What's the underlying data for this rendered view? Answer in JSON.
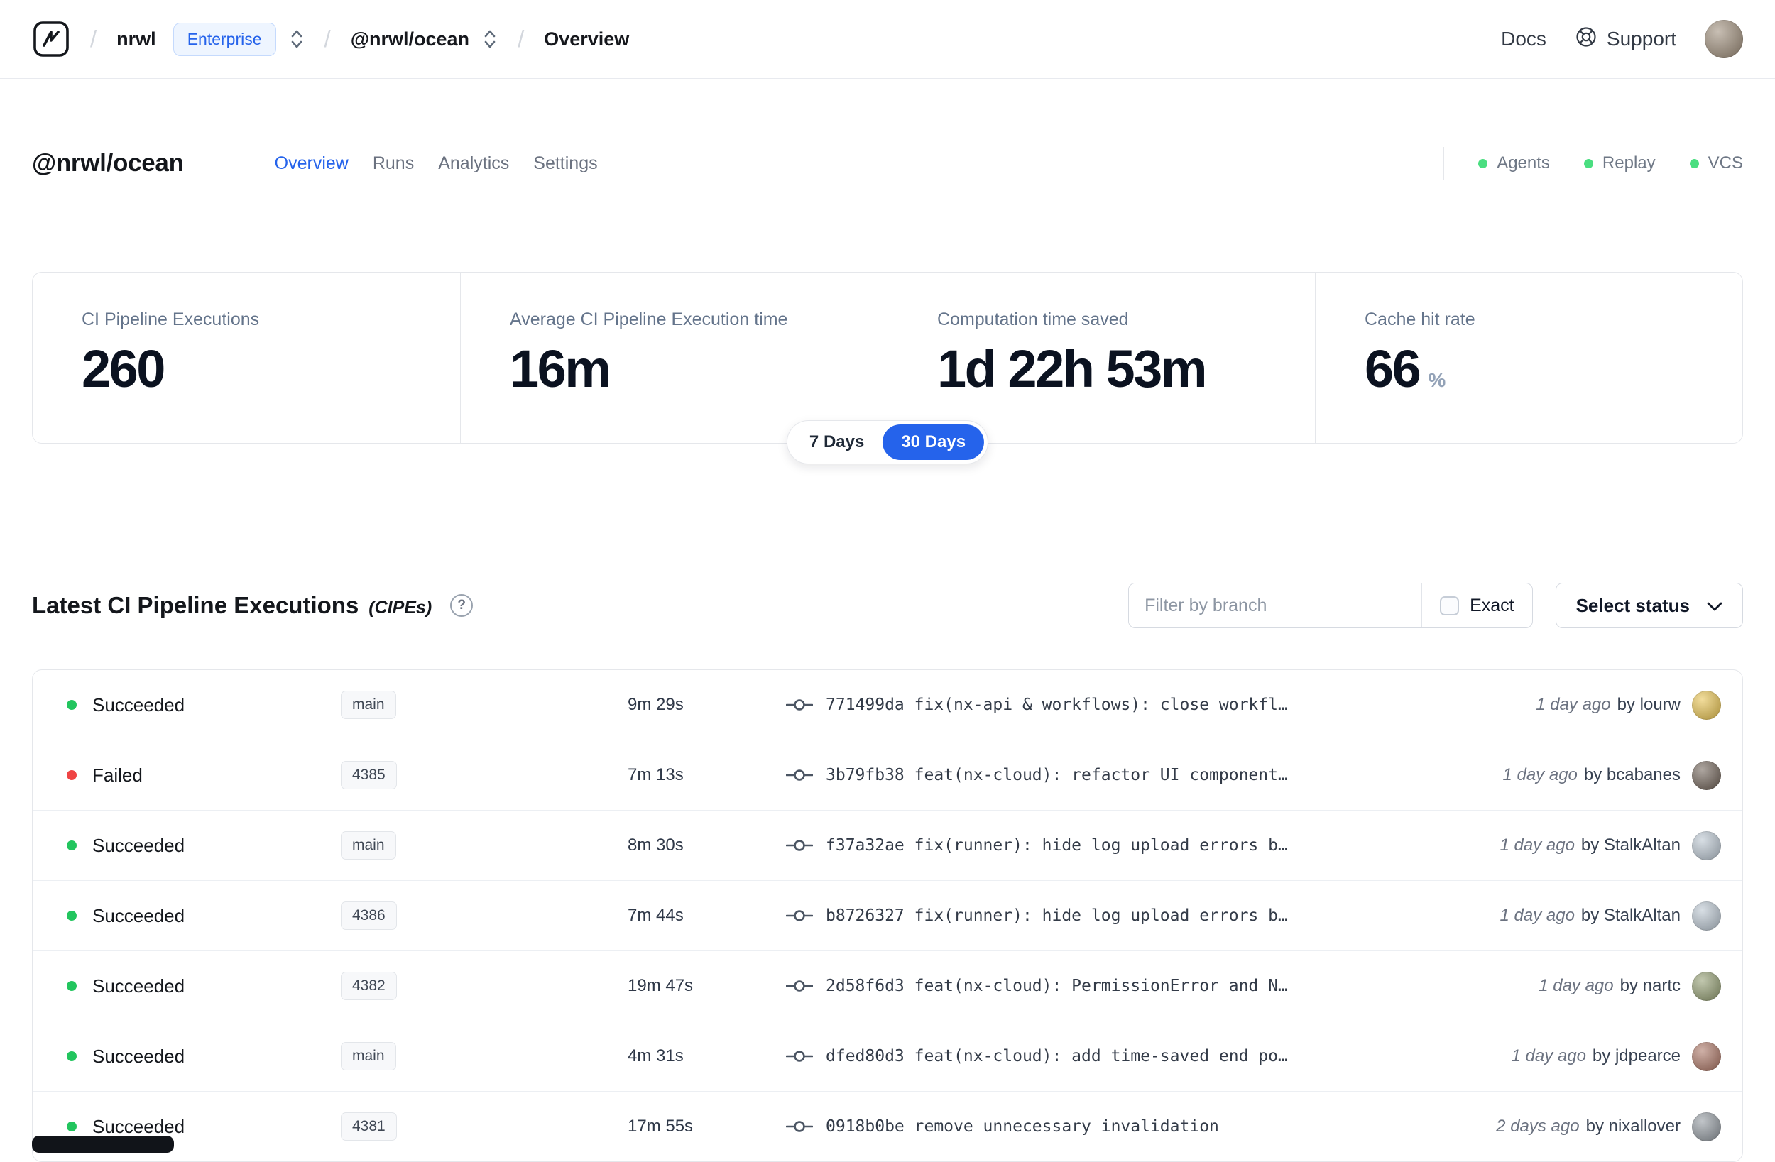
{
  "navbar": {
    "separator": "/",
    "org": "nrwl",
    "badge": "Enterprise",
    "workspace": "@nrwl/ocean",
    "page": "Overview",
    "docs": "Docs",
    "support": "Support"
  },
  "header": {
    "title": "@nrwl/ocean",
    "tabs": [
      {
        "label": "Overview",
        "active": true
      },
      {
        "label": "Runs",
        "active": false
      },
      {
        "label": "Analytics",
        "active": false
      },
      {
        "label": "Settings",
        "active": false
      }
    ],
    "status_dot_color": "#4ade80",
    "statuses": [
      {
        "label": "Agents"
      },
      {
        "label": "Replay"
      },
      {
        "label": "VCS"
      }
    ]
  },
  "stats": {
    "cards": [
      {
        "label": "CI Pipeline Executions",
        "value": "260"
      },
      {
        "label": "Average CI Pipeline Execution time",
        "value": "16m"
      },
      {
        "label": "Computation time saved",
        "value": "1d 22h 53m"
      },
      {
        "label": "Cache hit rate",
        "value": "66",
        "suffix": "%"
      }
    ],
    "range": [
      {
        "label": "7 Days",
        "active": false
      },
      {
        "label": "30 Days",
        "active": true
      }
    ]
  },
  "section": {
    "title": "Latest CI Pipeline Executions",
    "subtitle": "(CIPEs)",
    "help": "?",
    "filter_placeholder": "Filter by branch",
    "exact_label": "Exact",
    "status_select": "Select status"
  },
  "table": {
    "rows": [
      {
        "status": "Succeeded",
        "status_color": "#22c55e",
        "branch": "main",
        "duration": "9m 29s",
        "commit": "771499da fix(nx-api & workflows): close workfl…",
        "time": "1 day ago",
        "author": "by lourw",
        "avatar_color": "#e7c14b"
      },
      {
        "status": "Failed",
        "status_color": "#ef4444",
        "branch": "4385",
        "duration": "7m 13s",
        "commit": "3b79fb38 feat(nx-cloud): refactor UI component…",
        "time": "1 day ago",
        "author": "by bcabanes",
        "avatar_color": "#6b5d52"
      },
      {
        "status": "Succeeded",
        "status_color": "#22c55e",
        "branch": "main",
        "duration": "8m 30s",
        "commit": "f37a32ae fix(runner): hide log upload errors b…",
        "time": "1 day ago",
        "author": "by StalkAltan",
        "avatar_color": "#b8c4cf"
      },
      {
        "status": "Succeeded",
        "status_color": "#22c55e",
        "branch": "4386",
        "duration": "7m 44s",
        "commit": "b8726327 fix(runner): hide log upload errors b…",
        "time": "1 day ago",
        "author": "by StalkAltan",
        "avatar_color": "#b8c4cf"
      },
      {
        "status": "Succeeded",
        "status_color": "#22c55e",
        "branch": "4382",
        "duration": "19m 47s",
        "commit": "2d58f6d3 feat(nx-cloud): PermissionError and N…",
        "time": "1 day ago",
        "author": "by nartc",
        "avatar_color": "#8f9a6d"
      },
      {
        "status": "Succeeded",
        "status_color": "#22c55e",
        "branch": "main",
        "duration": "4m 31s",
        "commit": "dfed80d3 feat(nx-cloud): add time-saved end po…",
        "time": "1 day ago",
        "author": "by jdpearce",
        "avatar_color": "#a8705f"
      },
      {
        "status": "Succeeded",
        "status_color": "#22c55e",
        "branch": "4381",
        "duration": "17m 55s",
        "commit": "0918b0be remove unnecessary invalidation",
        "time": "2 days ago",
        "author": "by nixallover",
        "avatar_color": "#8e959c"
      }
    ]
  },
  "colors": {
    "accent": "#2563eb",
    "success": "#22c55e",
    "failed": "#ef4444"
  }
}
